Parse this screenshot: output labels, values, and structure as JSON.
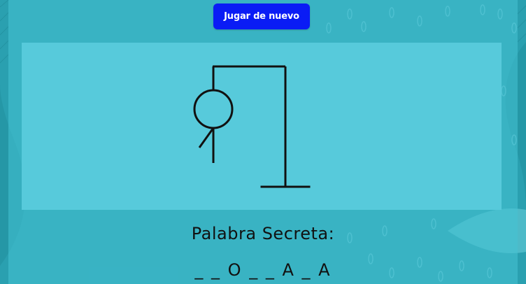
{
  "game": {
    "replay_label": "Jugar de nuevo",
    "secret_label": "Palabra Secreta:",
    "masked_word": "_ _ O _ _ A _ A",
    "wrong_guesses": 3
  },
  "colors": {
    "background": "#2aa0b0",
    "stage": "#57cadb",
    "button": "#0a1cf5",
    "ink": "#111111"
  }
}
